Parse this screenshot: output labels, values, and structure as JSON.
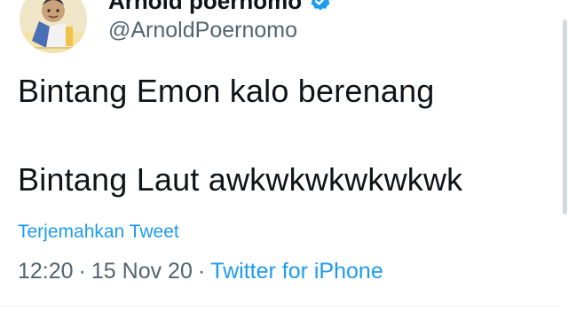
{
  "author": {
    "display_name": "Arnold poernomo",
    "handle": "@ArnoldPoernomo",
    "verified": true,
    "verified_color": "#1d9bf0",
    "avatar_icon": "cartoon-avatar-icon"
  },
  "tweet": {
    "line1": "Bintang Emon kalo berenang",
    "line2": "Bintang Laut awkwkwkwkwkwk",
    "translate_label": "Terjemahkan Tweet"
  },
  "meta": {
    "time": "12:20",
    "separator": "·",
    "date": "15 Nov 20",
    "source": "Twitter for iPhone"
  },
  "colors": {
    "link": "#1d9bf0",
    "text": "#0f1419",
    "muted": "#536471"
  }
}
